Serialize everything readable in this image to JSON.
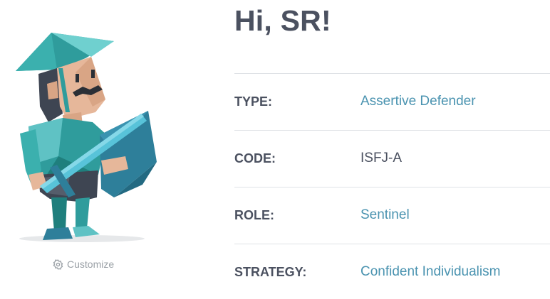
{
  "greeting": "Hi, SR!",
  "customize": {
    "icon": "gear-icon",
    "label": "Customize"
  },
  "avatar": {
    "icon": "defender-character-illustration"
  },
  "profile": [
    {
      "label": "TYPE:",
      "value": "Assertive Defender",
      "is_link": true
    },
    {
      "label": "CODE:",
      "value": "ISFJ-A",
      "is_link": false
    },
    {
      "label": "ROLE:",
      "value": "Sentinel",
      "is_link": true
    },
    {
      "label": "STRATEGY:",
      "value": "Confident Individualism",
      "is_link": true
    }
  ],
  "colors": {
    "heading": "#4b5160",
    "link": "#4a93b0",
    "muted": "#9aa0a6",
    "divider": "#dfe2e6",
    "teal_dark": "#1f7f7d",
    "teal_light": "#5fc2c4",
    "shield_blue": "#2e7f9a"
  }
}
